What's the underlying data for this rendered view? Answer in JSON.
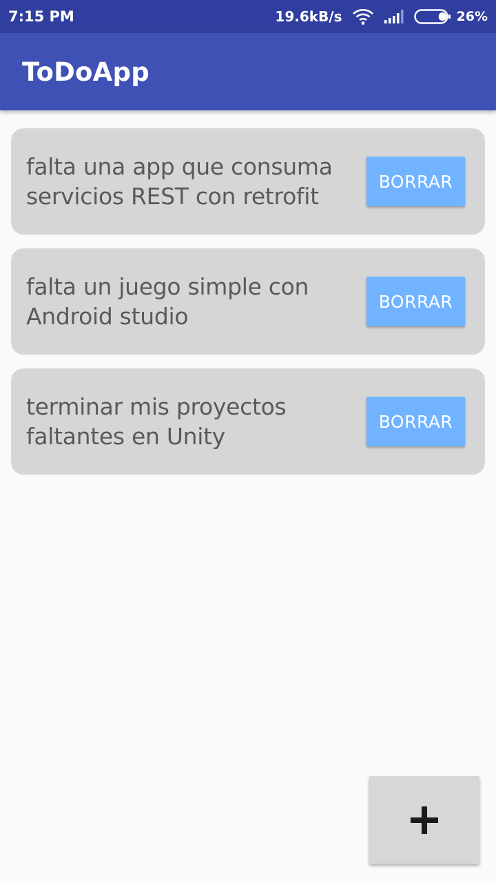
{
  "status_bar": {
    "time": "7:15 PM",
    "network_speed": "19.6kB/s",
    "battery_percent": "26%",
    "icons": [
      "wifi-icon",
      "signal-icon",
      "battery-icon"
    ],
    "battery_level": 0.26
  },
  "app_bar": {
    "title": "ToDoApp",
    "color": "#3f51b5"
  },
  "tasks": [
    {
      "text": "falta una app que consuma servicios REST con retrofit",
      "delete_label": "BORRAR"
    },
    {
      "text": "falta un juego simple con Android studio",
      "delete_label": "BORRAR"
    },
    {
      "text": "terminar mis proyectos faltantes en Unity",
      "delete_label": "BORRAR"
    }
  ],
  "add_button": {
    "icon": "plus-icon"
  },
  "colors": {
    "status_bar": "#303f9f",
    "card": "#d6d6d6",
    "delete_button": "#71b3ff",
    "background": "#fafafa"
  }
}
